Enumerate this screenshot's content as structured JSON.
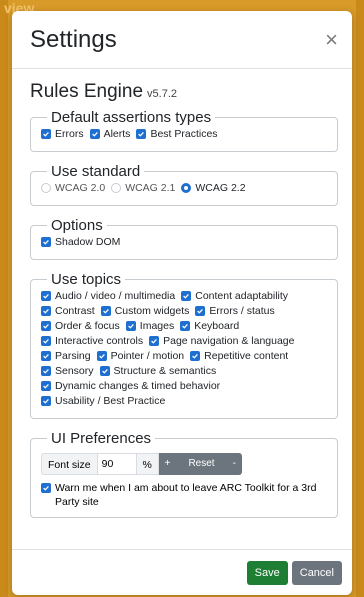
{
  "background_text": "view",
  "modal": {
    "title": "Settings",
    "close_glyph": "×"
  },
  "rules_engine": {
    "title": "Rules Engine",
    "version": "v5.7.2"
  },
  "assertions": {
    "legend": "Default assertions types",
    "items": [
      {
        "label": "Errors",
        "checked": true
      },
      {
        "label": "Alerts",
        "checked": true
      },
      {
        "label": "Best Practices",
        "checked": true
      }
    ]
  },
  "standard": {
    "legend": "Use standard",
    "options": [
      {
        "label": "WCAG 2.0",
        "selected": false
      },
      {
        "label": "WCAG 2.1",
        "selected": false
      },
      {
        "label": "WCAG 2.2",
        "selected": true
      }
    ]
  },
  "options": {
    "legend": "Options",
    "items": [
      {
        "label": "Shadow DOM",
        "checked": true
      }
    ]
  },
  "topics": {
    "legend": "Use topics",
    "items": [
      {
        "label": "Audio / video / multimedia",
        "checked": true
      },
      {
        "label": "Content adaptability",
        "checked": true
      },
      {
        "label": "Contrast",
        "checked": true
      },
      {
        "label": "Custom widgets",
        "checked": true
      },
      {
        "label": "Errors / status",
        "checked": true
      },
      {
        "label": "Order & focus",
        "checked": true
      },
      {
        "label": "Images",
        "checked": true
      },
      {
        "label": "Keyboard",
        "checked": true
      },
      {
        "label": "Interactive controls",
        "checked": true
      },
      {
        "label": "Page navigation & language",
        "checked": true
      },
      {
        "label": "Parsing",
        "checked": true
      },
      {
        "label": "Pointer / motion",
        "checked": true
      },
      {
        "label": "Repetitive content",
        "checked": true
      },
      {
        "label": "Sensory",
        "checked": true
      },
      {
        "label": "Structure & semantics",
        "checked": true
      },
      {
        "label": "Dynamic changes & timed behavior",
        "checked": true
      },
      {
        "label": "Usability / Best Practice",
        "checked": true
      }
    ]
  },
  "ui_preferences": {
    "legend": "UI Preferences",
    "font_size_label": "Font size",
    "font_size_value": "90",
    "font_size_unit": "%",
    "increase_label": "+",
    "reset_label": "Reset",
    "decrease_label": "-",
    "warn_label": "Warn me when I am about to leave ARC Toolkit for a 3rd Party site",
    "warn_checked": true
  },
  "footer": {
    "save_label": "Save",
    "cancel_label": "Cancel"
  },
  "colors": {
    "accent": "#1f6fd1",
    "save": "#1e7e34",
    "secondary": "#6c757d",
    "backdrop": "#d89a28"
  }
}
